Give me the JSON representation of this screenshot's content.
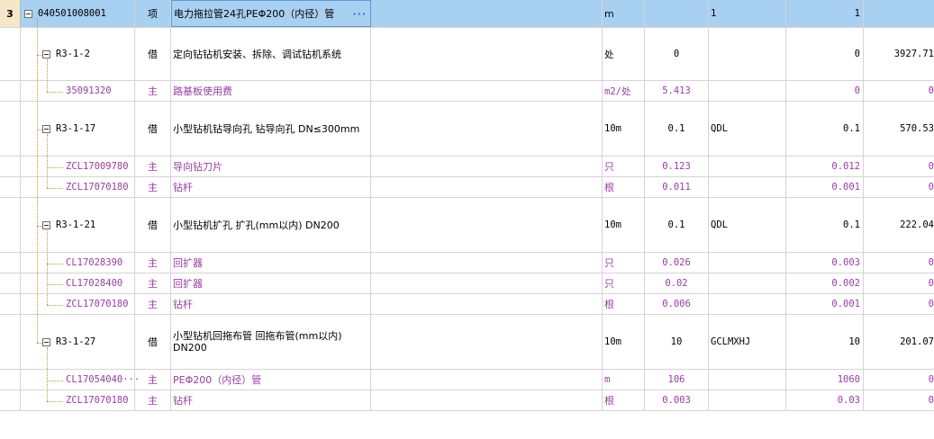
{
  "colors": {
    "selection": "#a8d0f0",
    "material_text": "#9a3ca4",
    "row_header": "#f6e7c9"
  },
  "header_row": {
    "index": "3",
    "code": "040501008001",
    "type": "项",
    "name": "电力拖拉管24孔PEΦ200（内径）管",
    "name_button": "···",
    "unit": "m",
    "qty": "",
    "code2": "1",
    "amount": "1",
    "price": ""
  },
  "rows": [
    {
      "code": "R3-1-2",
      "type": "借",
      "name": "定向钻钻机安装、拆除、调试钻机系统",
      "unit": "处",
      "qty": "0",
      "code2": "",
      "amount": "0",
      "price": "3927.71"
    },
    {
      "code": "35091320",
      "type": "主",
      "name": "路基板使用费",
      "unit": "m2/处",
      "qty": "5.413",
      "code2": "",
      "amount": "0",
      "price": "0"
    },
    {
      "code": "R3-1-17",
      "type": "借",
      "name": "小型钻机钻导向孔 钻导向孔 DN≤300mm",
      "unit": "10m",
      "qty": "0.1",
      "code2": "QDL",
      "amount": "0.1",
      "price": "570.53"
    },
    {
      "code": "ZCL17009780",
      "type": "主",
      "name": "导向钻刀片",
      "unit": "只",
      "qty": "0.123",
      "code2": "",
      "amount": "0.012",
      "price": "0"
    },
    {
      "code": "ZCL17070180",
      "type": "主",
      "name": "钻杆",
      "unit": "根",
      "qty": "0.011",
      "code2": "",
      "amount": "0.001",
      "price": "0"
    },
    {
      "code": "R3-1-21",
      "type": "借",
      "name": "小型钻机扩孔 扩孔(mm以内) DN200",
      "unit": "10m",
      "qty": "0.1",
      "code2": "QDL",
      "amount": "0.1",
      "price": "222.04"
    },
    {
      "code": "CL17028390",
      "type": "主",
      "name": "回扩器",
      "unit": "只",
      "qty": "0.026",
      "code2": "",
      "amount": "0.003",
      "price": "0"
    },
    {
      "code": "CL17028400",
      "type": "主",
      "name": "回扩器",
      "unit": "只",
      "qty": "0.02",
      "code2": "",
      "amount": "0.002",
      "price": "0"
    },
    {
      "code": "ZCL17070180",
      "type": "主",
      "name": "钻杆",
      "unit": "根",
      "qty": "0.006",
      "code2": "",
      "amount": "0.001",
      "price": "0"
    },
    {
      "code": "R3-1-27",
      "type": "借",
      "name": "小型钻机回拖布管 回拖布管(mm以内) DN200",
      "unit": "10m",
      "qty": "10",
      "code2": "GCLMXHJ",
      "amount": "10",
      "price": "201.07"
    },
    {
      "code": "CL17054040···",
      "type": "主",
      "name": "PEΦ200（内径）管",
      "unit": "m",
      "qty": "106",
      "code2": "",
      "amount": "1060",
      "price": "0"
    },
    {
      "code": "ZCL17070180",
      "type": "主",
      "name": "钻杆",
      "unit": "根",
      "qty": "0.003",
      "code2": "",
      "amount": "0.03",
      "price": "0"
    }
  ]
}
